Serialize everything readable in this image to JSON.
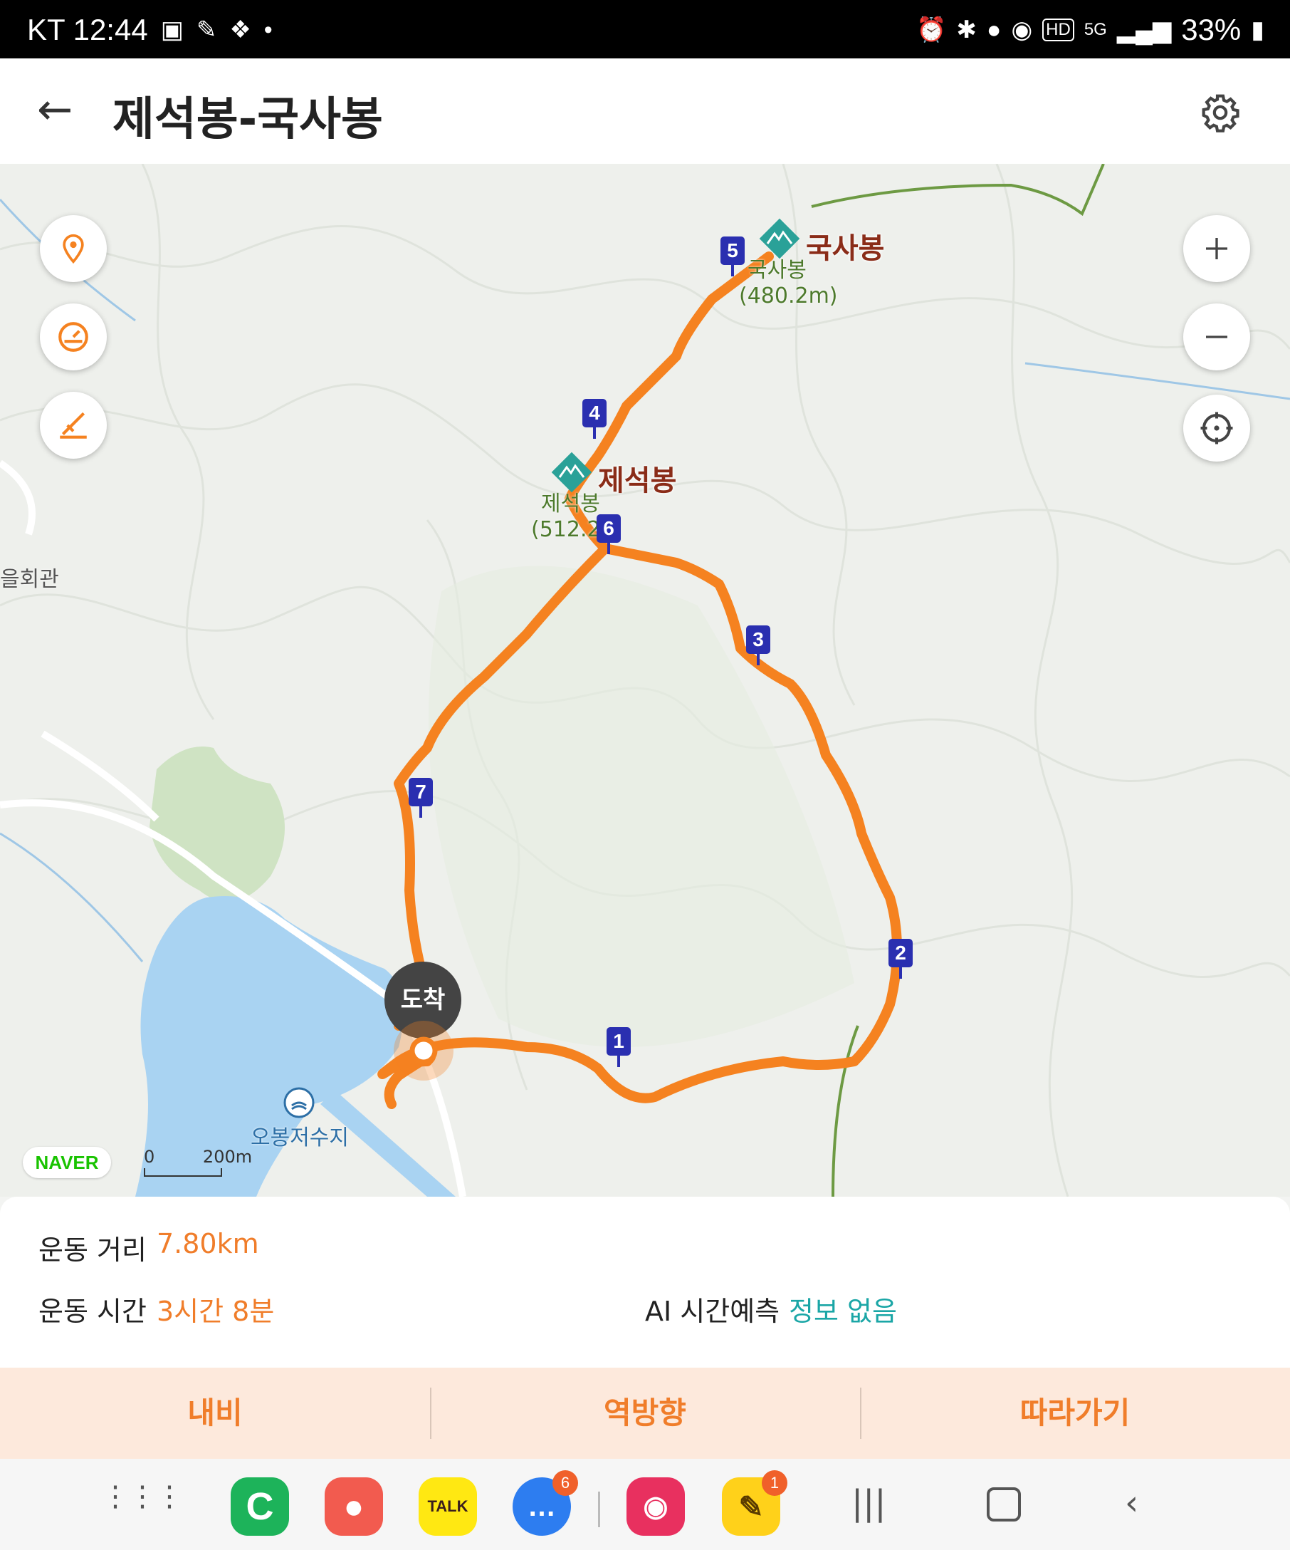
{
  "status_bar": {
    "carrier_time": "KT 12:44",
    "battery": "33%",
    "network": "5G",
    "hd": "HD"
  },
  "header": {
    "title": "제석봉-국사봉"
  },
  "map": {
    "peaks": [
      {
        "name": "국사봉",
        "sub_name": "국사봉",
        "elevation": "(480.2m)"
      },
      {
        "name": "제석봉",
        "sub_name": "제석봉",
        "elevation": "(512.2"
      }
    ],
    "markers": [
      "1",
      "2",
      "3",
      "4",
      "5",
      "6",
      "7"
    ],
    "arrival_label": "도착",
    "water_label": "오봉저수지",
    "place_label": "을회관",
    "scale": {
      "zero": "0",
      "distance": "200m"
    },
    "provider": "NAVER",
    "route_color": "#f58220"
  },
  "info": {
    "distance_label": "운동 거리",
    "distance_value": "7.80km",
    "time_label": "운동 시간",
    "time_value": "3시간 8분",
    "ai_label": "AI 시간예측",
    "ai_value": "정보 없음"
  },
  "actions": {
    "navi": "내비",
    "reverse": "역방향",
    "follow": "따라가기"
  },
  "dock": {
    "talk": "TALK",
    "messages_badge": "6",
    "runner_badge": "1"
  }
}
